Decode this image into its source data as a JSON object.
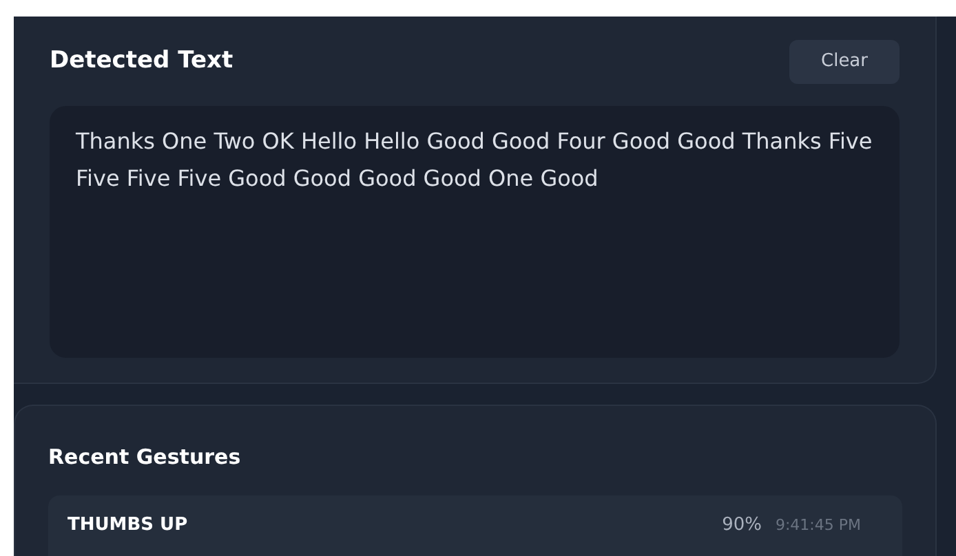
{
  "detected_text": {
    "title": "Detected Text",
    "clear_button": "Clear",
    "text": "Thanks One Two OK Hello Hello Good Good Four Good Good Thanks Five Five Five Five Good Good Good Good One Good"
  },
  "recent_gestures": {
    "title": "Recent Gestures",
    "items": [
      {
        "name": "THUMBS UP",
        "confidence": "90%",
        "time": "9:41:45 PM"
      }
    ]
  }
}
